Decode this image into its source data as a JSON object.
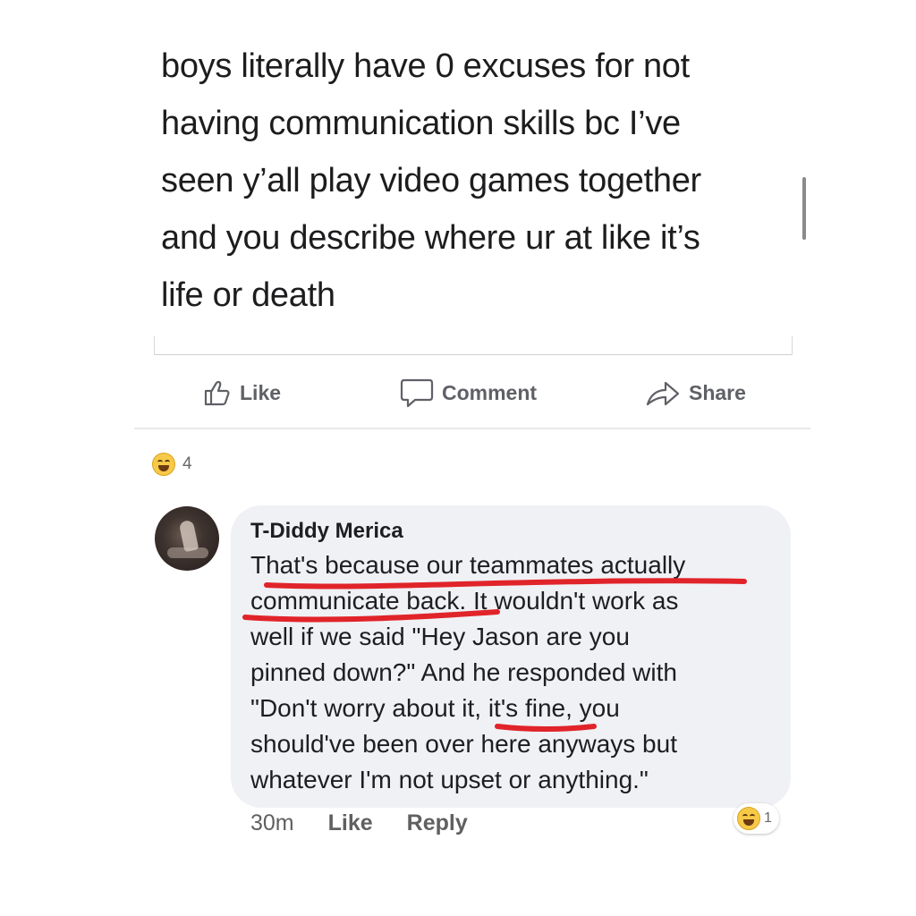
{
  "post": {
    "lines": [
      "boys literally have 0 excuses for not",
      "having communication skills bc I’ve",
      "seen y’all play video games together",
      "and you describe where ur at like it’s",
      "life or death"
    ]
  },
  "actions": {
    "like": {
      "label": "Like",
      "icon": "thumbs-up-icon"
    },
    "comment": {
      "label": "Comment",
      "icon": "speech-bubble-icon"
    },
    "share": {
      "label": "Share",
      "icon": "share-arrow-icon"
    }
  },
  "reactions": {
    "icon": "haha-emoji-icon",
    "count": "4"
  },
  "comment": {
    "author": "T-Diddy Merica",
    "lines": [
      "That's because our teammates actually",
      "communicate back. It wouldn't work as",
      "well if we said \"Hey Jason are you",
      "pinned down?\" And he responded with",
      "\"Don't worry about it, it's fine, you",
      "should've been over here anyways but",
      "whatever I'm not upset or anything.\""
    ],
    "time": "30m",
    "like_label": "Like",
    "reply_label": "Reply",
    "reaction": {
      "icon": "haha-emoji-icon",
      "count": "1"
    }
  },
  "colors": {
    "underline": "#e0242a",
    "bubble": "#f0f1f4",
    "action_text": "#5f6166"
  }
}
